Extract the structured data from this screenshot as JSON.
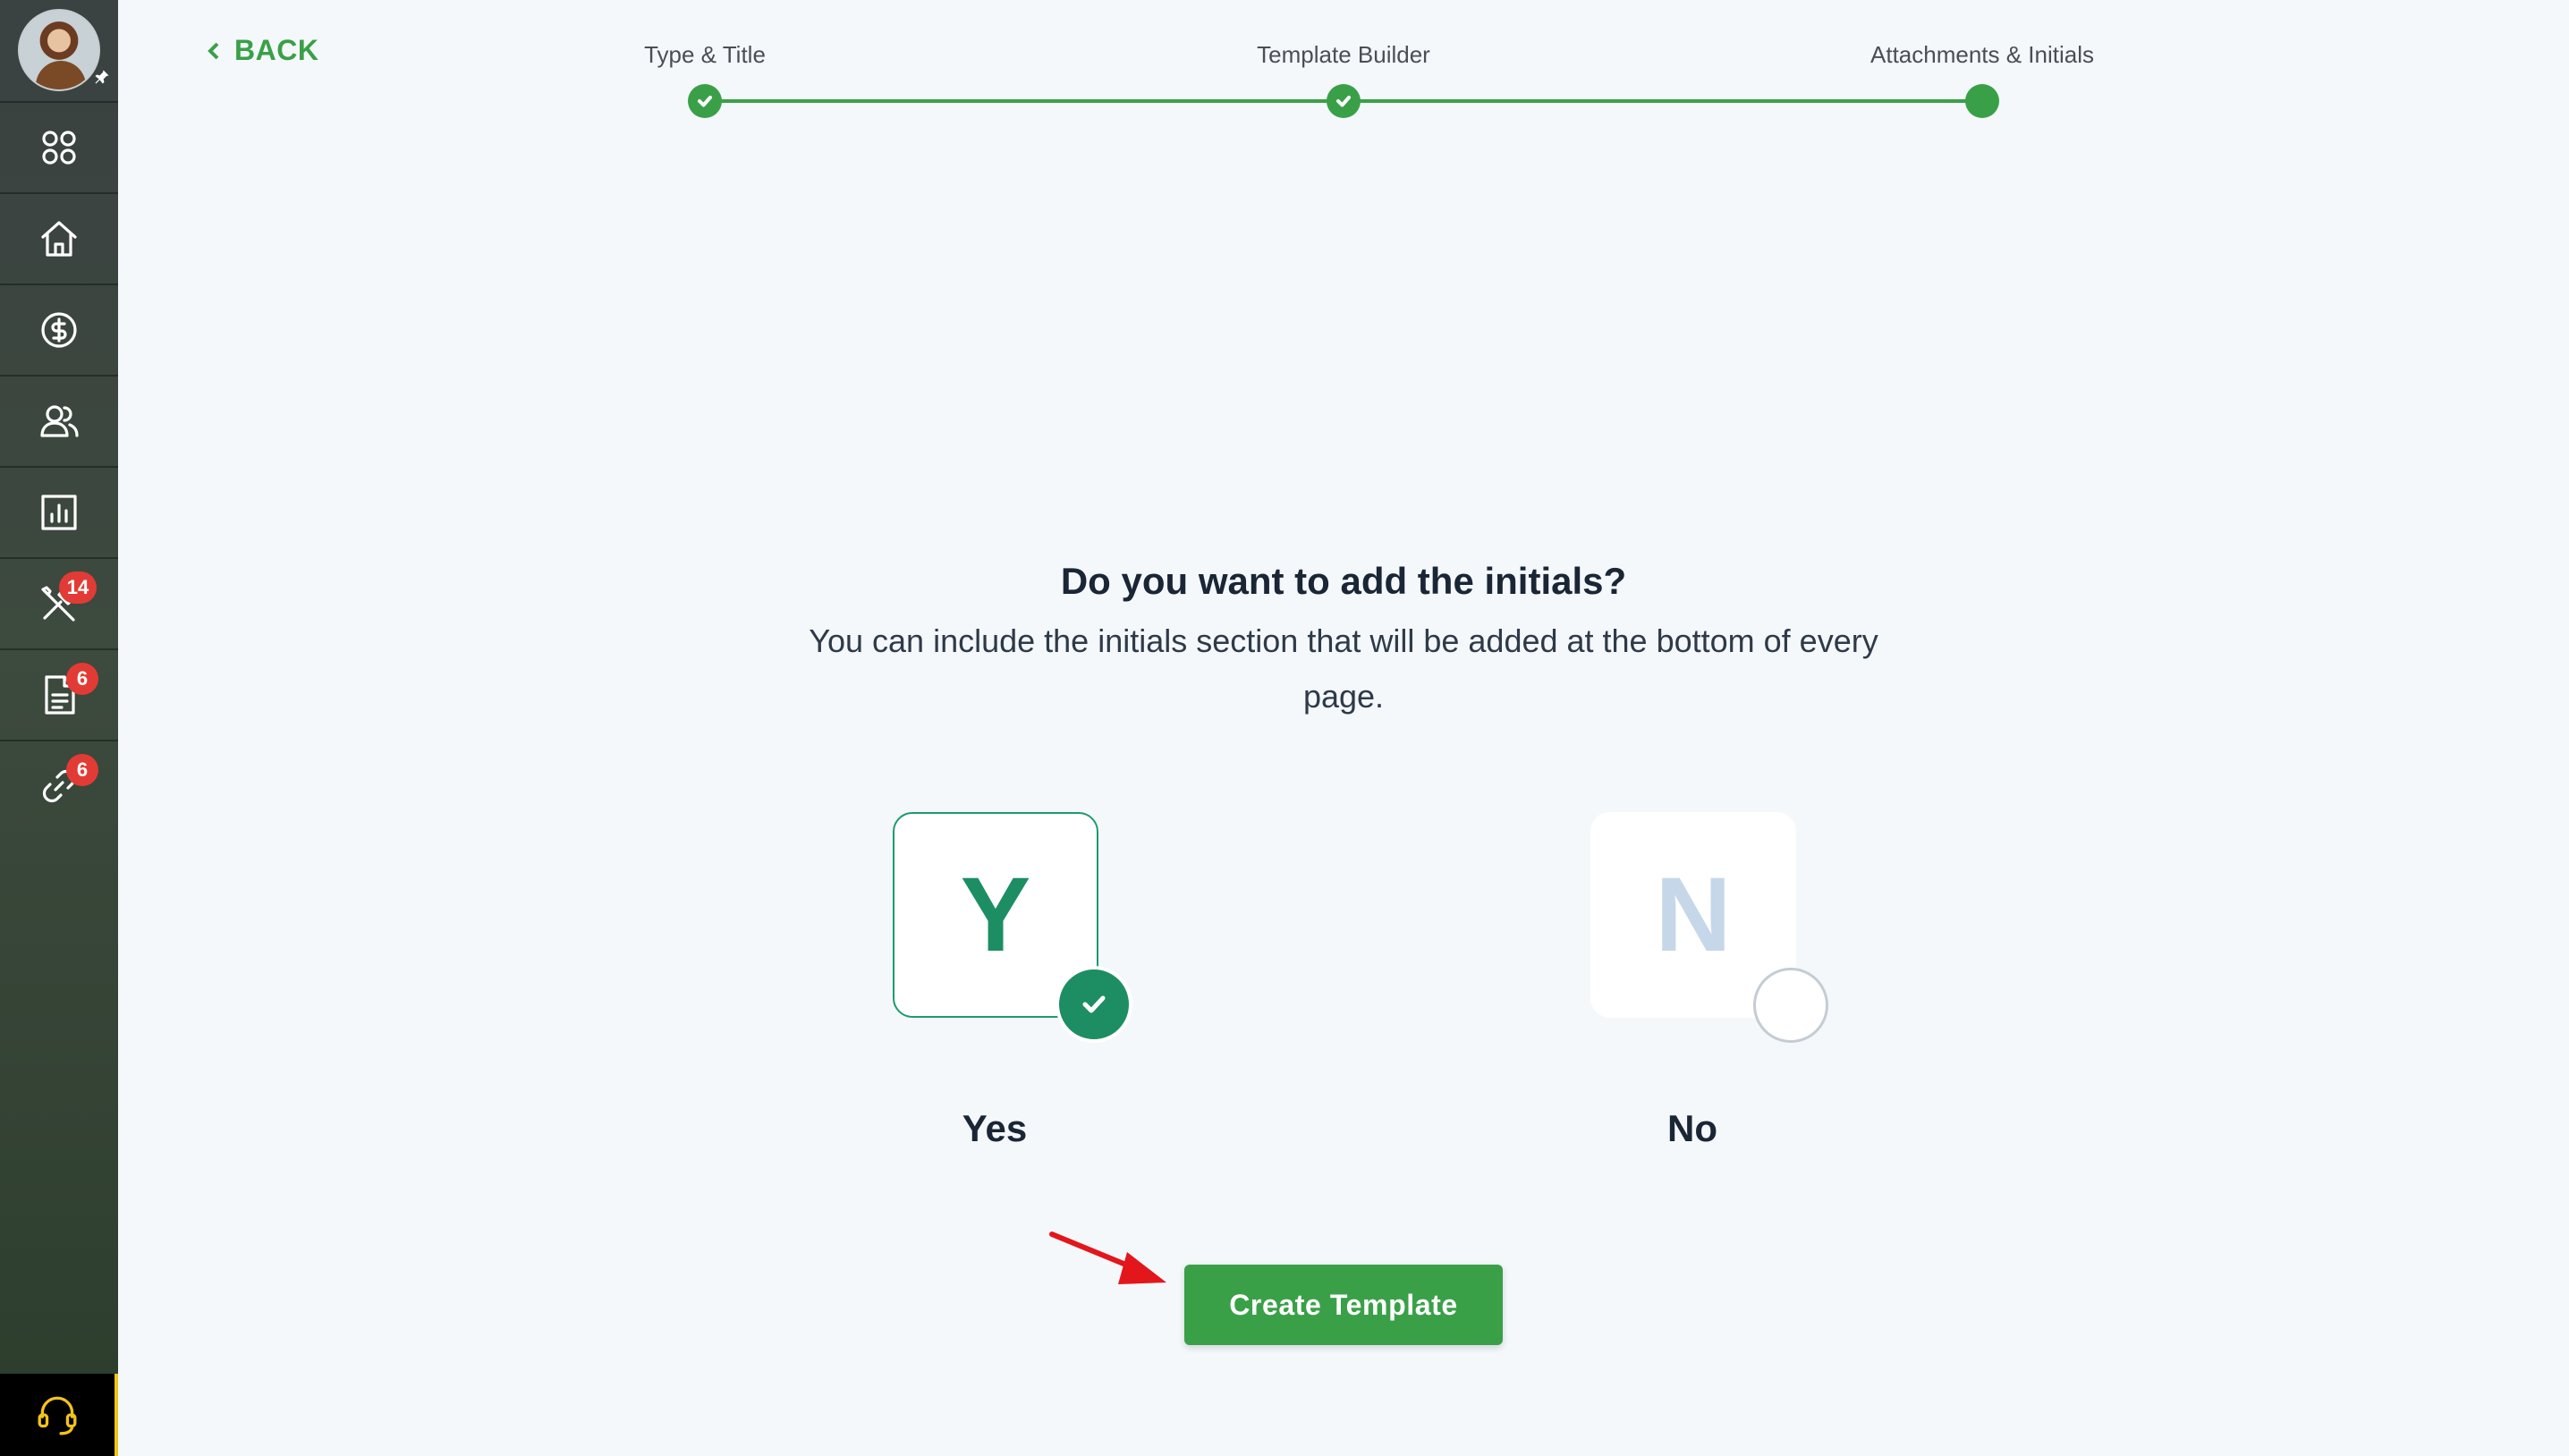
{
  "sidebar": {
    "avatar_alt": "",
    "items": [
      {
        "icon": "apps-grid-icon",
        "badge": ""
      },
      {
        "icon": "home-icon",
        "badge": ""
      },
      {
        "icon": "dollar-circle-icon",
        "badge": ""
      },
      {
        "icon": "users-icon",
        "badge": ""
      },
      {
        "icon": "bar-chart-icon",
        "badge": ""
      },
      {
        "icon": "tools-icon",
        "badge": "14"
      },
      {
        "icon": "document-icon",
        "badge": "6"
      },
      {
        "icon": "link-icon",
        "badge": "6"
      }
    ],
    "support_icon": "headset-icon"
  },
  "header": {
    "back_label": "BACK"
  },
  "stepper": {
    "steps": [
      {
        "label": "Type & Title",
        "status": "complete"
      },
      {
        "label": "Template Builder",
        "status": "complete"
      },
      {
        "label": "Attachments & Initials",
        "status": "current"
      }
    ]
  },
  "main": {
    "question": "Do you want to add the initials?",
    "description": "You can include the initials section that will be added at the bottom of every page.",
    "options": [
      {
        "letter": "Y",
        "label": "Yes",
        "selected": true
      },
      {
        "letter": "N",
        "label": "No",
        "selected": false
      }
    ],
    "submit_label": "Create Template"
  },
  "colors": {
    "accent_green": "#3aa048",
    "selected_teal": "#1d8e63",
    "badge_red": "#e23b35",
    "support_yellow": "#f2c418",
    "annotation_arrow": "#e3161b"
  }
}
